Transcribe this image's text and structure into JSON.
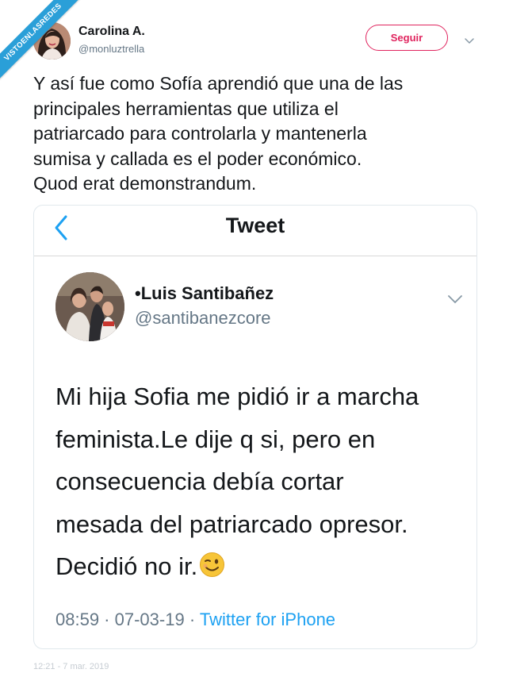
{
  "watermark": "VISTOENLASREDES",
  "author": {
    "name": "Carolina A.",
    "handle": "@monluztrella"
  },
  "follow_label": "Seguir",
  "tweet_text": "Y así fue como Sofía aprendió que una de las\nprincipales herramientas que utiliza el\npatriarcado para controlarla y mantenerla\nsumisa y callada es el poder económico.\nQuod erat demonstrandum.",
  "embedded": {
    "header_title": "Tweet",
    "author_name": "•Luis Santibañez",
    "author_handle": "@santibanezcore",
    "text": "Mi hija Sofia me pidió ir a marcha\nfeminista.Le dije q si, pero en\nconsecuencia debía cortar\nmesada del patriarcado opresor.\nDecidió no ir.",
    "time": "08:59",
    "date": "07-03-19",
    "separator": " · ",
    "source": "Twitter for iPhone"
  },
  "footer_partial": "12:21 - 7 mar. 2019",
  "colors": {
    "follow": "#e0245e",
    "link": "#1da1f2",
    "muted": "#657786",
    "ribbon": "#2a9fd8"
  },
  "icons": {
    "back": "chevron-left-icon",
    "caret": "chevron-down-icon",
    "emoji": "winking-face-icon"
  }
}
